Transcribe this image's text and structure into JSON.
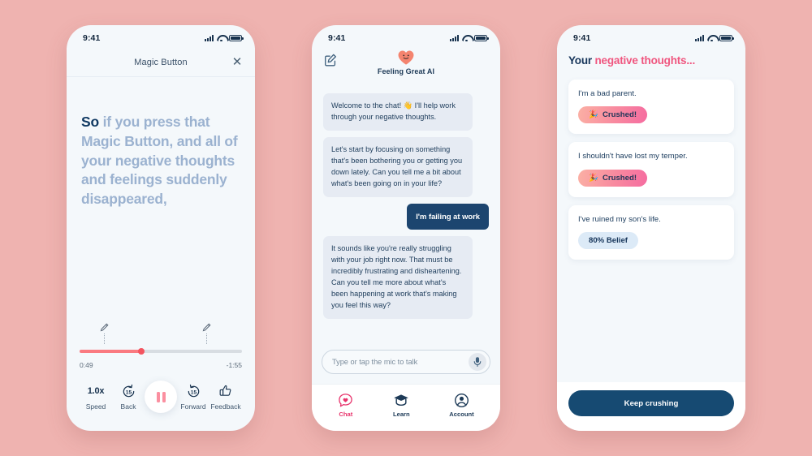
{
  "theme": {
    "page_background": "#efb3b0",
    "navy": "#16355a",
    "pink": "#f0567f",
    "coral": "#fa7a80",
    "card": "#ffffff",
    "screen": "#f4f8fb"
  },
  "status_bar": {
    "time": "9:41",
    "icons": [
      "signal-icon",
      "wifi-icon",
      "battery-icon"
    ]
  },
  "phone1": {
    "header": {
      "title": "Magic Button",
      "close_icon": "close-icon",
      "close_label": "✕"
    },
    "transcript": {
      "highlight": "So",
      "rest": " if you press that Magic Button, and all of your negative thoughts and feelings suddenly disappeared,"
    },
    "player": {
      "elapsed": "0:49",
      "remaining": "-1:55",
      "progress_percent": 38,
      "markers": [
        {
          "name": "bookmark-marker-1",
          "position_percent": 15,
          "icon": "pencil-icon"
        },
        {
          "name": "bookmark-marker-2",
          "position_percent": 78,
          "icon": "pencil-icon"
        }
      ],
      "controls": [
        {
          "name": "speed-control",
          "value": "1.0x",
          "label": "Speed",
          "icon": "speed-text"
        },
        {
          "name": "back-15-button",
          "value": "15",
          "label": "Back",
          "icon": "rewind-15-icon"
        },
        {
          "name": "play-pause-button",
          "value": "",
          "label": "",
          "icon": "pause-icon"
        },
        {
          "name": "forward-15-button",
          "value": "15",
          "label": "Forward",
          "icon": "forward-15-icon"
        },
        {
          "name": "feedback-button",
          "value": "",
          "label": "Feedback",
          "icon": "thumbs-up-icon"
        }
      ]
    }
  },
  "phone2": {
    "header": {
      "compose_icon": "compose-icon",
      "logo_icon": "heart-smile-icon",
      "brand_name": "Feeling Great AI"
    },
    "messages": [
      {
        "from": "ai",
        "text": "Welcome to the chat! 👋 I'll help work through your negative thoughts."
      },
      {
        "from": "ai",
        "text": "Let's start by focusing on something that's been bothering you or getting you down lately. Can you tell me a bit about what's been going on in your life?"
      },
      {
        "from": "me",
        "text": "I'm failing at work"
      },
      {
        "from": "ai",
        "text": "It sounds like you're really struggling with your job right now. That must be incredibly frustrating and disheartening. Can you tell me more about what's been happening at work that's making you feel this way?"
      }
    ],
    "composer": {
      "placeholder": "Type or tap the mic to talk",
      "value": "",
      "mic_icon": "microphone-icon"
    },
    "tabs": [
      {
        "label": "Chat",
        "icon": "chat-heart-icon",
        "active": true
      },
      {
        "label": "Learn",
        "icon": "graduation-cap-icon",
        "active": false
      },
      {
        "label": "Account",
        "icon": "account-circle-icon",
        "active": false
      }
    ]
  },
  "phone3": {
    "title": {
      "lead": "Your ",
      "emphasis": "negative thoughts..."
    },
    "cards": [
      {
        "text": "I'm a bad parent.",
        "badge": {
          "label": "Crushed!",
          "emoji": "🎉",
          "type": "crushed"
        }
      },
      {
        "text": "I shouldn't have lost my temper.",
        "badge": {
          "label": "Crushed!",
          "emoji": "🎉",
          "type": "crushed"
        }
      },
      {
        "text": "I've ruined my son's life.",
        "badge": {
          "label": "80% Belief",
          "emoji": "",
          "type": "belief"
        }
      }
    ],
    "footer": {
      "button_label": "Keep crushing"
    }
  }
}
